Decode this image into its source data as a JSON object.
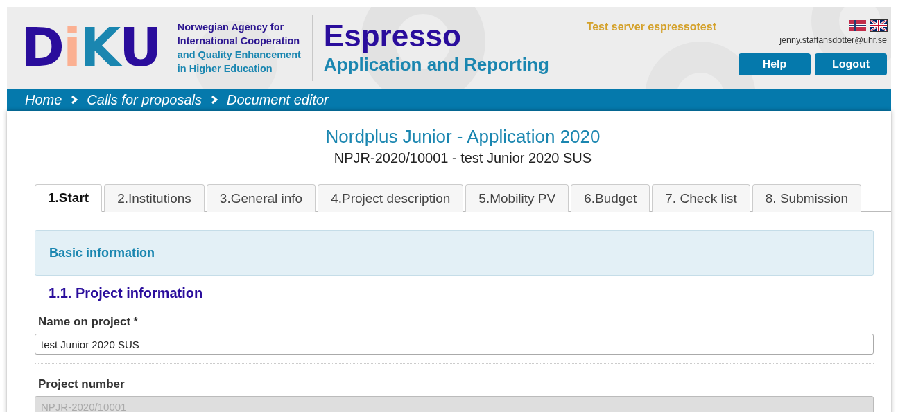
{
  "logo": {
    "letters": [
      "D",
      "i",
      "K",
      "U"
    ],
    "agency_lines": [
      {
        "text": "Norwegian Agency for",
        "kind": "primary"
      },
      {
        "text": "International Cooperation",
        "kind": "primary"
      },
      {
        "text": "and Quality Enhancement",
        "kind": "secondary"
      },
      {
        "text": "in Higher Education",
        "kind": "secondary"
      }
    ]
  },
  "app": {
    "title": "Espresso",
    "subtitle": "Application and Reporting"
  },
  "server_notice": "Test server espressotest",
  "languages": [
    {
      "kind": "norwegian",
      "selected": false
    },
    {
      "kind": "english",
      "selected": true
    }
  ],
  "user_email": "jenny.staffansdotter@uhr.se",
  "header_buttons": [
    "Help",
    "Logout"
  ],
  "breadcrumbs": [
    "Home",
    "Calls for proposals",
    "Document editor"
  ],
  "document": {
    "title": "Nordplus Junior - Application 2020",
    "subtitle": "NPJR-2020/10001 - test Junior 2020 SUS"
  },
  "tabs": [
    {
      "label": "1.Start",
      "selected": true
    },
    {
      "label": "2.Institutions",
      "selected": false
    },
    {
      "label": "3.General info",
      "selected": false
    },
    {
      "label": "4.Project description",
      "selected": false
    },
    {
      "label": "5.Mobility PV",
      "selected": false
    },
    {
      "label": "6.Budget",
      "selected": false
    },
    {
      "label": "7. Check list",
      "selected": false
    },
    {
      "label": "8. Submission",
      "selected": false
    }
  ],
  "panel_heading": "Basic information",
  "section_heading": "1.1. Project information",
  "fields": [
    {
      "label": "Name on project",
      "required_mark": "*",
      "value": "test Junior 2020 SUS",
      "disabled": false
    },
    {
      "label": "Project number",
      "value": "NPJR-2020/10001",
      "disabled": true
    }
  ]
}
